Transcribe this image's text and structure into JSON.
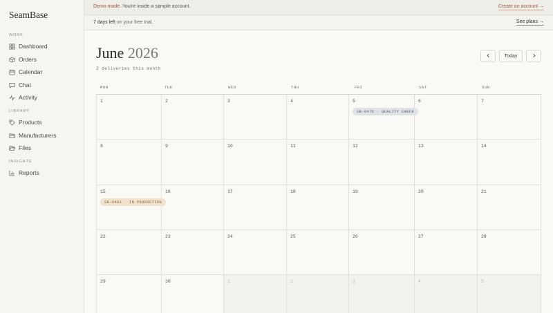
{
  "app": {
    "name": "SeamBase"
  },
  "sidebar": {
    "sections": [
      {
        "label": "WORK",
        "items": [
          {
            "label": "Dashboard",
            "icon": "grid-icon"
          },
          {
            "label": "Orders",
            "icon": "box-icon"
          },
          {
            "label": "Calendar",
            "icon": "calendar-icon"
          },
          {
            "label": "Chat",
            "icon": "chat-icon"
          },
          {
            "label": "Activity",
            "icon": "activity-icon"
          }
        ]
      },
      {
        "label": "LIBRARY",
        "items": [
          {
            "label": "Products",
            "icon": "tag-icon"
          },
          {
            "label": "Manufacturers",
            "icon": "folder-icon"
          },
          {
            "label": "Files",
            "icon": "folder-open-icon"
          }
        ]
      },
      {
        "label": "INSIGHTS",
        "items": [
          {
            "label": "Reports",
            "icon": "bar-chart-icon"
          }
        ]
      }
    ]
  },
  "banners": {
    "demo": {
      "accent": "Demo mode.",
      "text": " You're inside a sample account.",
      "link": "Create an account →"
    },
    "trial": {
      "bold": "7 days left",
      "text": " on your free trial.",
      "link": "See plans →"
    }
  },
  "calendar": {
    "month": "June",
    "year": "2026",
    "summary": "2 deliveries this month",
    "today_label": "Today",
    "weekdays": [
      "MON",
      "TUE",
      "WED",
      "THU",
      "FRI",
      "SAT",
      "SUN"
    ],
    "weeks": [
      [
        {
          "day": "1"
        },
        {
          "day": "2"
        },
        {
          "day": "3"
        },
        {
          "day": "4"
        },
        {
          "day": "5",
          "event": "SB-0475 · QUALITY CHECK",
          "event_kind": "qc"
        },
        {
          "day": "6"
        },
        {
          "day": "7"
        }
      ],
      [
        {
          "day": "8"
        },
        {
          "day": "9"
        },
        {
          "day": "10"
        },
        {
          "day": "11"
        },
        {
          "day": "12"
        },
        {
          "day": "13"
        },
        {
          "day": "14"
        }
      ],
      [
        {
          "day": "15",
          "event": "SB-0481 · IN PRODUCTION",
          "event_kind": "ip"
        },
        {
          "day": "16"
        },
        {
          "day": "17"
        },
        {
          "day": "18"
        },
        {
          "day": "19"
        },
        {
          "day": "20"
        },
        {
          "day": "21"
        }
      ],
      [
        {
          "day": "22"
        },
        {
          "day": "23"
        },
        {
          "day": "24"
        },
        {
          "day": "25"
        },
        {
          "day": "26"
        },
        {
          "day": "27"
        },
        {
          "day": "28"
        }
      ],
      [
        {
          "day": "29"
        },
        {
          "day": "30"
        },
        {
          "day": "1",
          "outside": true
        },
        {
          "day": "2",
          "outside": true
        },
        {
          "day": "3",
          "outside": true
        },
        {
          "day": "4",
          "outside": true
        },
        {
          "day": "5",
          "outside": true
        }
      ]
    ]
  }
}
